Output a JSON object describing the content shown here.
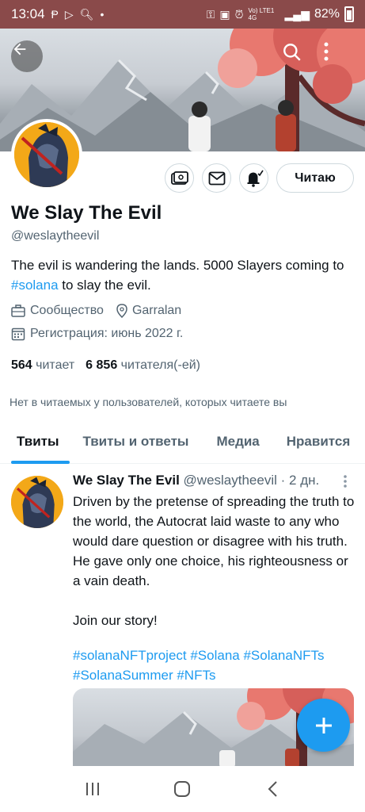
{
  "status_bar": {
    "time": "13:04",
    "network": "Vo) LTE1 4G",
    "battery": "82%"
  },
  "profile": {
    "name": "We Slay The Evil",
    "handle": "@weslaytheevil",
    "follow_label": "Читаю",
    "bio_text": "The evil is wandering the lands. 5000 Slayers coming to ",
    "bio_link": "#solana",
    "bio_end": " to slay the evil.",
    "category": "Сообщество",
    "location": "Garralan",
    "joined": "Регистрация: июнь 2022 г.",
    "following_count": "564",
    "following_label": "читает",
    "followers_count": "6 856",
    "followers_label": "читателя(-ей)",
    "no_mutual": "Нет в читаемых у пользователей, которых читаете вы"
  },
  "tabs": [
    {
      "label": "Твиты"
    },
    {
      "label": "Твиты и ответы"
    },
    {
      "label": "Медиа"
    },
    {
      "label": "Нравится"
    }
  ],
  "tweet": {
    "name": "We Slay The Evil",
    "handle": "@weslaytheevil",
    "separator": "·",
    "time": "2 дн.",
    "text": "Driven by the pretense of spreading the truth to the world, the Autocrat laid waste to any who would dare question or disagree with his truth. He gave only one choice, his righteousness or a vain death.\n\nJoin our story!",
    "hashtags": "#solanaNFTproject #Solana #SolanaNFTs #SolanaSummer #NFTs"
  },
  "colors": {
    "accent": "#1d9bf0",
    "status_bar": "#8a4a4a",
    "blossom": "#e8786f"
  },
  "icons": {
    "back": "arrow-left-icon",
    "search": "search-icon",
    "more": "more-vertical-icon",
    "tip": "tip-jar-icon",
    "message": "envelope-icon",
    "notify": "bell-check-icon",
    "compose": "plus-icon"
  }
}
